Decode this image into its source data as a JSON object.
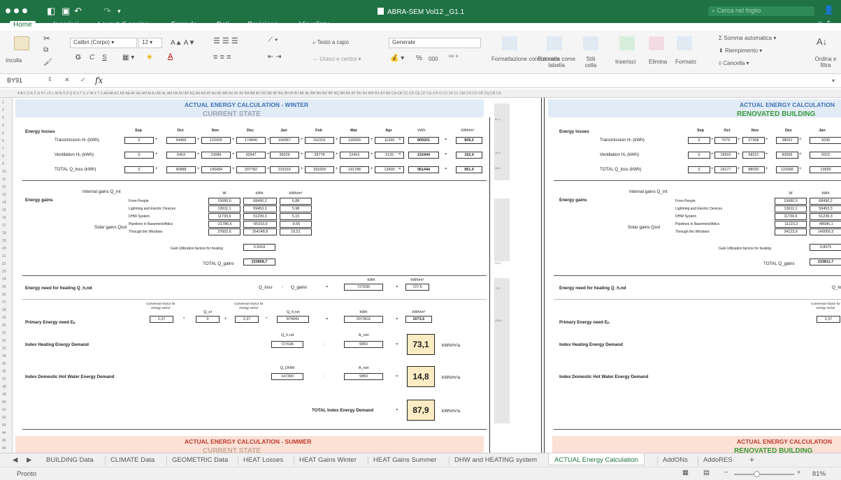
{
  "app": {
    "title": "ABRA-SEM Vol12 _G1.1",
    "search_placeholder": "Cerca nel foglio",
    "accent": "#1f7244"
  },
  "menu_tabs": [
    "Home",
    "Inserisci",
    "Layout di pagina",
    "Formule",
    "Dati",
    "Revisione",
    "Visualizza"
  ],
  "ribbon": {
    "paste": "Incolla",
    "font_name": "Calibri (Corpo)",
    "font_size": "12",
    "wrap_text": "Testo a capo",
    "merge_center": "Unisci e centra",
    "number_format": "Generale",
    "cond_format": "Formattazione condizionale",
    "format_table": "Formatta come tabella",
    "cell_styles": "Stili cella",
    "insert": "Inserisci",
    "delete": "Elimina",
    "format": "Formato",
    "autosum": "Somma automatica",
    "fill": "Riempimento",
    "clear": "Cancella",
    "sort_filter": "Ordina e filtra",
    "bold": "G",
    "italic": "C",
    "underline": "S",
    "percent": "%",
    "thousands": "000"
  },
  "formula_bar": {
    "name_box": "BY91",
    "fx": "fx"
  },
  "col_header": "A B C D E F G H I J K L M N O P Q R S T U V W X Y Z AA AB AC AD AE AF AG AH AI AJ AK AL AM AN AO AP AQ AR AS AT AU AV AW AX AY AZ BA BB BC BD BE BF BG BH BI BJ BK BL BM BN BO BP BQ BR BS BT BU BV BW BX BY BZ CA CB CC CD CE CF CG CH CI CJ CK CL CM CN CO CP CQ CR CS",
  "sections": {
    "left_title": "ACTUAL ENERGY CALCULATION - WINTER",
    "left_sub": "CURRENT STATE",
    "right_title": "ACTUAL ENERGY CALCULATION",
    "right_sub": "RENOVATED BUILDING",
    "summer_title": "ACTUAL ENERGY CALCULATION - SUMMER",
    "summer_sub": "CURRENT STATE",
    "summer_right_title": "ACTUAL ENERGY CALCULATION",
    "summer_right_sub": "RENOVATED BUILDING"
  },
  "losses": {
    "label": "Energy losses",
    "months": [
      "Sep",
      "Oct",
      "Nov",
      "Dec",
      "Jan",
      "Feb",
      "Mar",
      "Apr"
    ],
    "unit_kwh": "kWh",
    "unit_kwhm2": "kWh/m²",
    "rows": [
      {
        "label": "Transmission Hₜ (kWh)",
        "values": [
          "0",
          "54465",
          "122425",
          "174840",
          "194367",
          "152331",
          "118300",
          "11260"
        ],
        "total": "809201",
        "per_m2": "809,0"
      },
      {
        "label": "Ventilation Hᵥ (kWh)",
        "values": [
          "0",
          "6453",
          "23089",
          "32947",
          "36029",
          "28778",
          "22401",
          "2120"
        ],
        "total": "152444",
        "per_m2": "152,4"
      },
      {
        "label": "TOTAL Q_loss (kWh)",
        "values": [
          "0",
          "40888",
          "145494",
          "207782",
          "231016",
          "181659",
          "141788",
          "13400"
        ],
        "total": "961444",
        "per_m2": "961,4"
      }
    ]
  },
  "right_losses": {
    "label": "Energy losses",
    "months": [
      "Sep",
      "Oct",
      "Nov",
      "Dec",
      "Jan"
    ],
    "rows": [
      {
        "label": "Transmission Hₜ (kWh)",
        "values": [
          "0",
          "7074",
          "27308",
          "38031",
          "4338"
        ]
      },
      {
        "label": "Ventilation Hᵥ (kWh)",
        "values": [
          "0",
          "16502",
          "58221",
          "83565",
          "9323"
        ]
      },
      {
        "label": "TOTAL Q_loss (kWh)",
        "values": [
          "0",
          "24177",
          "88030",
          "122066",
          "13659"
        ]
      }
    ]
  },
  "gains": {
    "label": "Energy gains",
    "internal": "Internal gains Q_int",
    "solar": "Solar gains Qsol",
    "hdr": [
      "W",
      "kWh",
      "kWh/m²"
    ],
    "rows": [
      {
        "label": "From People",
        "w": "15680,0",
        "kwh": "68490,2",
        "m2": "6,88"
      },
      {
        "label": "Lightning and Electric Devices",
        "w": "13611,1",
        "kwh": "59453,3",
        "m2": "5,98"
      },
      {
        "label": "DHW System",
        "w": "11730,6",
        "kwh": "51239,3",
        "m2": "5,15"
      },
      {
        "label": "Pipelines in Basement/Attics",
        "w": "-21786,6",
        "kwh": "-95163,9",
        "m2": "-9,56"
      },
      {
        "label": "Through the Windows",
        "w": "37602,6",
        "kwh": "164248,8",
        "m2": "16,51"
      }
    ],
    "util_label": "Gain Utilization factors for heating",
    "util": "0,9418",
    "total_label": "TOTAL Q_gains",
    "total": "233808,7"
  },
  "right_gains": {
    "rows": [
      {
        "w": "15680,0",
        "kwh": "68490,2"
      },
      {
        "w": "13611,1",
        "kwh": "59453,3"
      },
      {
        "w": "11730,6",
        "kwh": "51239,3"
      },
      {
        "w": "-11123,3",
        "kwh": "-48586,1"
      },
      {
        "w": "34123,9",
        "kwh": "149059,3"
      }
    ],
    "util": "0,8575",
    "total": "233811,7"
  },
  "need": {
    "label": "Energy need for heating Q_h,nd",
    "qloss": "Q_loss",
    "qgains": "Q_gains",
    "kwh": "727636",
    "per_m2": "727,6"
  },
  "primary": {
    "label": "Primary Energy need Eₚ",
    "conv": "Conversion factor for energy vector",
    "conv_val": "2,37",
    "qel": "0",
    "conv2": "2,37",
    "qh": "874941",
    "kwh": "2073611",
    "per_m2": "2073,6",
    "qh_label": "Q_h,nd",
    "qel_label": "Q_el"
  },
  "idx_heating": {
    "label": "Index Heating Energy Demand",
    "q": "727636",
    "a": "9950",
    "value": "73,1",
    "unit": "kWh/m²a",
    "qlabel": "Q_h,nd",
    "alabel": "A_net"
  },
  "idx_dhw": {
    "label": "Index Domestic Hot Water Energy Demand",
    "q": "147300",
    "a": "9950",
    "value": "14,8",
    "unit": "kWh/m²a",
    "qlabel": "Q_DHW",
    "alabel": "A_net"
  },
  "idx_total": {
    "label": "TOTAL Index Energy Demand",
    "value": "87,9",
    "unit": "kWh/m²a"
  },
  "side_vals": [
    "81,3",
    "15,3",
    "96,6",
    "23,5",
    "73,2",
    "208,4"
  ],
  "sheet_tabs": [
    "BUILDING Data",
    "CLIMATE Data",
    "GEOMETRIC Data",
    "HEAT Losses",
    "HEAT Gains Winter",
    "HEAT Gains Summer",
    "DHW and HEATING system",
    "ACTUAL Energy Calculation",
    "AddONs",
    "AddoRES"
  ],
  "status": {
    "ready": "Pronto",
    "zoom": "81%"
  }
}
